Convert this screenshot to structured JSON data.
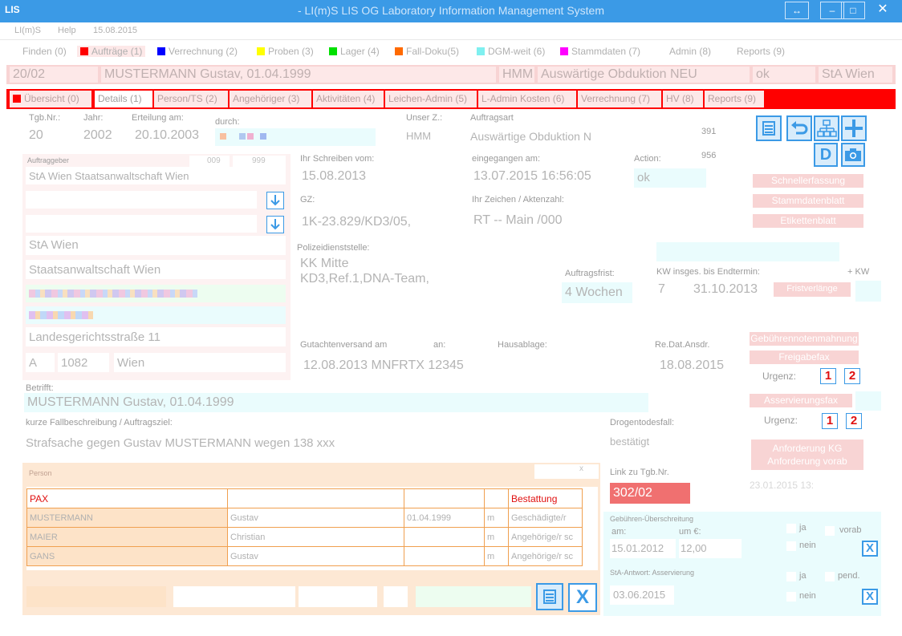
{
  "window": {
    "logo": "LIS",
    "title": "- LI(m)S LIS OG Laboratory Information Management System",
    "restore_glyph": "↔",
    "minimize_glyph": "–",
    "maximize_glyph": "□",
    "close_glyph": "✕"
  },
  "menu": [
    "LI(m)S",
    "Help",
    "15.08.2015"
  ],
  "main_tabs": [
    {
      "label": "Finden (0)",
      "color": ""
    },
    {
      "label": "Aufträge (1)",
      "color": "#ff0000"
    },
    {
      "label": "Verrechnung (2)",
      "color": "#0000ff"
    },
    {
      "label": "Proben (3)",
      "color": "#ffff00"
    },
    {
      "label": "Lager (4)",
      "color": "#00e000"
    },
    {
      "label": "Fall-Doku(5)",
      "color": "#ff6a00"
    },
    {
      "label": "DGM-weit (6)",
      "color": "#7ff0f0"
    },
    {
      "label": "Stammdaten (7)",
      "color": "#ff00ff"
    },
    {
      "label": "Admin (8)",
      "color": ""
    },
    {
      "label": "Reports (9)",
      "color": ""
    }
  ],
  "patient": {
    "case_no": "20/02",
    "name": "MUSTERMANN  Gustav, 01.04.1999",
    "dept": "HMM",
    "order_type": "Auswärtige Obduktion  NEU",
    "status": "ok",
    "authority": "StA Wien"
  },
  "sub_tabs": [
    "Übersicht (0)",
    "Details (1)",
    "Person/TS (2)",
    "Angehöriger (3)",
    "Aktivitäten (4)",
    "Leichen-Admin (5)",
    "L-Admin Kosten (6)",
    "Verrechnung (7)",
    "HV (8)",
    "Reports (9)"
  ],
  "details": {
    "tgb_label": "Tgb.Nr.:",
    "tgb_value": "20",
    "jahr_label": "Jahr:",
    "jahr_value": "2002",
    "erteilung_label": "Erteilung am:",
    "erteilung_value": "20.10.2003",
    "durch_label": "durch:",
    "unser_z_label": "Unser Z.:",
    "unser_z_value": "HMM",
    "auftragsart_label": "Auftragsart",
    "auftragsart_value": "Auswärtige Obduktion  N",
    "num_391": "391",
    "num_956": "956",
    "auftraggeber_label": "Auftraggeber",
    "ag_code1": "009",
    "ag_code2": "999",
    "ag_name": "StA Wien Staatsanwaltschaft Wien",
    "ag_short": "StA Wien",
    "ag_long": "Staatsanwaltschaft Wien",
    "ag_street": "Landesgerichtsstraße 11",
    "ag_country": "A",
    "ag_zip": "1082",
    "ag_city": "Wien",
    "ihr_schreiben_label": "Ihr Schreiben vom:",
    "ihr_schreiben_value": "15.08.2013",
    "eingegangen_label": "eingegangen am:",
    "eingegangen_value": "13.07.2015 16:56:05",
    "action_label": "Action:",
    "action_value": "ok",
    "gz_label": "GZ:",
    "gz_value": "1K-23.829/KD3/05,",
    "ihr_zeichen_label": "Ihr Zeichen / Aktenzahl:",
    "ihr_zeichen_value": "RT -- Main /000",
    "polizei_label": "Polizeidienststelle:",
    "polizei_line1": "KK Mitte",
    "polizei_line2": "KD3,Ref.1,DNA-Team,",
    "auftragsfrist_label": "Auftragsfrist:",
    "auftragsfrist_value": "4 Wochen",
    "kw_label": "KW insges. bis Endtermin:",
    "kw_value": "7",
    "endtermin_value": "31.10.2013",
    "kw_suffix": "+ KW",
    "gutachten_label": "Gutachtenversand am",
    "an_label": "an:",
    "hausablage_label": "Hausablage:",
    "gutachten_value": "12.08.2013  MNFRTX 12345",
    "redatansdr_label": "Re.Dat.Ansdr.",
    "redatansdr_value": "18.08.2015",
    "betrifft_label": "Betrifft:",
    "betrifft_value": "MUSTERMANN  Gustav, 01.04.1999",
    "kurz_label": "kurze Fallbeschreibung / Auftragsziel:",
    "kurz_value": "Strafsache gegen Gustav MUSTERMANN wegen  138 xxx",
    "drogen_label": "Drogentodesfall:",
    "drogen_value": "bestätigt",
    "link_label": "Link zu Tgb.Nr.",
    "link_value": "302/02",
    "link_date": "23.01.2015 13:"
  },
  "actions": {
    "schnellerfassung": "Schnellerfassung",
    "stammdatenblatt": "Stammdatenblatt",
    "etikettenblatt": "Etikettenblatt",
    "fristverlaengerung": "Fristverlänge",
    "gebuehrennoten": "Gebührennotenmahnung",
    "freigabefax": "Freigabefax",
    "urgenz_label": "Urgenz:",
    "u1": "1",
    "u2": "2",
    "asservierung": "Asservierungsfax",
    "anforderung_kg": "Anforderung KG",
    "anforderung_vorab": "Anforderung vorab",
    "d_label": "D"
  },
  "gebuehren": {
    "title": "Gebühren-Überschreitung",
    "am_label": "am:",
    "um_label": "um €:",
    "am_value": "15.01.2012",
    "um_value": "12,00",
    "ja": "ja",
    "nein": "nein",
    "vorab": "vorab",
    "x": "X"
  },
  "asserv": {
    "title": "StA-Antwort: Asservierung",
    "date_value": "03.06.2015",
    "ja": "ja",
    "nein": "nein",
    "pend": "pend.",
    "x": "X"
  },
  "person_panel": {
    "title": "Person",
    "close_glyph": "x",
    "header": [
      "PAX",
      "",
      "",
      "",
      "Bestattung"
    ],
    "rows": [
      [
        "MUSTERMANN",
        "Gustav",
        "01.04.1999",
        "m",
        "Geschädigte/r"
      ],
      [
        "MAIER",
        "Christian",
        "",
        "m",
        "Angehörige/r sc"
      ],
      [
        "GANS",
        "Gustav",
        "",
        "m",
        "Angehörige/r sc"
      ]
    ],
    "x": "X"
  },
  "colors": {
    "accent": "#3b9ae6",
    "alert": "#ff0000",
    "pink": "#f8d4d4",
    "cyan_field": "#eafcfd",
    "link_bg": "#f07070"
  }
}
